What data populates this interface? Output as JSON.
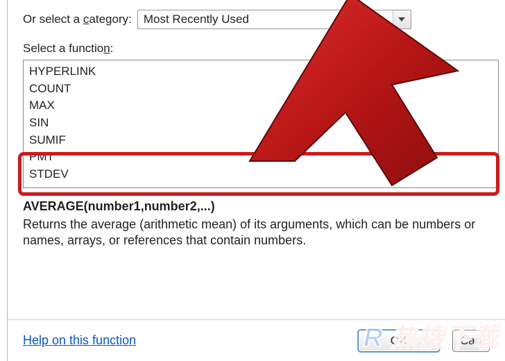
{
  "category": {
    "label_prefix": "Or select a ",
    "label_mnemonic": "c",
    "label_suffix": "ategory:",
    "value": "Most Recently Used"
  },
  "function_label_prefix": "Select a functio",
  "function_label_mnemonic": "n",
  "function_label_suffix": ":",
  "functions": [
    "HYPERLINK",
    "COUNT",
    "MAX",
    "SIN",
    "SUMIF",
    "PMT",
    "STDEV"
  ],
  "signature": "AVERAGE(number1,number2,...)",
  "description": "Returns the average (arithmetic mean) of its arguments, which can be numbers or names, arrays, or references that contain numbers.",
  "help_link": "Help on this function",
  "buttons": {
    "ok": "OK",
    "cancel": "Cancel"
  },
  "cancel_visible": "Can",
  "watermark": {
    "prefix": "R",
    "rest": " 热搜下载"
  }
}
